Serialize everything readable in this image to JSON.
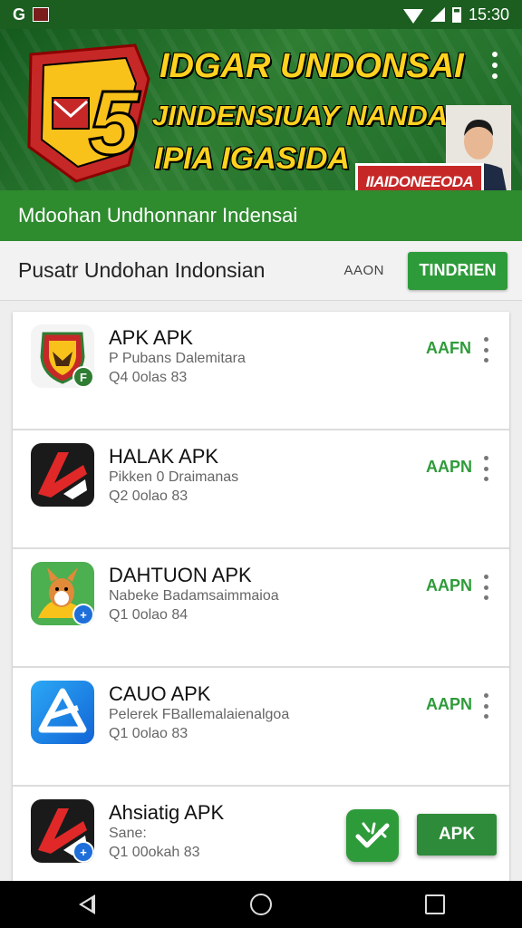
{
  "status_bar": {
    "left_text": "G",
    "time": "15:30",
    "icons": [
      "app-icon",
      "wifi-icon",
      "signal-icon",
      "battery-icon"
    ]
  },
  "banner": {
    "line1": "IDGAR UNDONSAI",
    "line2": "JINDENSIUAY NANDAKAHI",
    "line3": "IPIA IGASIDASK!",
    "badge": "IIAIDONEEODA",
    "shield_number": "5",
    "colors": {
      "background": "#1e6b28",
      "headline": "#ffd21f",
      "badge": "#c62828"
    }
  },
  "subtitle_bar": {
    "text": "Mdoohan   Undhonnanr Indensai"
  },
  "header": {
    "title": "Pusatr Undohan Indonsian",
    "small_label": "AAON",
    "button_label": "TINDRIEN"
  },
  "apps": [
    {
      "name": "APK APK",
      "developer": "P Pubans Dalemitara",
      "size": "Q4 0olas 83",
      "action": "AAFN",
      "icon": "shield-eagle-icon",
      "badge_color": "#2e7d32",
      "badge_glyph": "F"
    },
    {
      "name": "HALAK APK",
      "developer": "Pikken 0 Draimanas",
      "size": "Q2 0olao 83",
      "action": "AAPN",
      "icon": "red-arrow-logo-icon",
      "badge_color": "",
      "badge_glyph": ""
    },
    {
      "name": "DAHTUON APK",
      "developer": "Nabeke Badamsaimmaioa",
      "size": "Q1 0olao 84",
      "action": "AAPN",
      "icon": "cartoon-mascot-icon",
      "badge_color": "#1e6fd9",
      "badge_glyph": "+"
    },
    {
      "name": "CAUO APK",
      "developer": "Pelerek FBallemalaienalgoa",
      "size": "Q1 0olao 83",
      "action": "AAPN",
      "icon": "blue-triangle-logo-icon",
      "badge_color": "",
      "badge_glyph": ""
    },
    {
      "name": "Ahsiatig APK",
      "developer": "Sane:",
      "size": "Q1 00okah 83",
      "action": "",
      "icon": "red-arrow-logo-icon",
      "badge_color": "#1e6fd9",
      "badge_glyph": "+"
    }
  ],
  "floating": {
    "apk_label": "APK",
    "icon": "green-app-icon"
  },
  "colors": {
    "accent": "#2e9b3a",
    "dark_green": "#1b5e20"
  }
}
